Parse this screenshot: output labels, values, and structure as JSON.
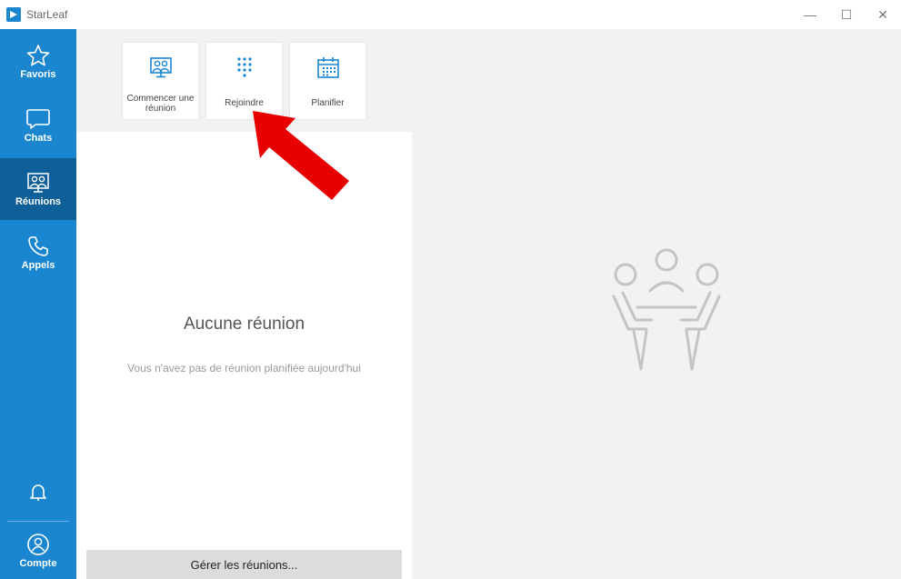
{
  "window": {
    "title": "StarLeaf",
    "minimize_glyph": "—",
    "maximize_glyph": "☐",
    "close_glyph": "✕"
  },
  "nav": {
    "items": [
      {
        "label": "Favoris",
        "icon": "star-icon",
        "active": false
      },
      {
        "label": "Chats",
        "icon": "chat-bubble-icon",
        "active": false
      },
      {
        "label": "Réunions",
        "icon": "meeting-icon",
        "active": true
      },
      {
        "label": "Appels",
        "icon": "phone-icon",
        "active": false
      }
    ],
    "bell_icon": "bell-icon",
    "account": {
      "label": "Compte",
      "icon": "account-icon"
    }
  },
  "actions": {
    "start": {
      "label_line1": "Commencer une",
      "label_line2": "réunion",
      "icon": "meeting-screen-icon"
    },
    "join": {
      "label": "Rejoindre",
      "icon": "dialpad-icon"
    },
    "schedule": {
      "label": "Planifier",
      "icon": "calendar-icon"
    }
  },
  "empty_state": {
    "title": "Aucune réunion",
    "subtitle": "Vous n'avez pas de réunion planifiée aujourd'hui"
  },
  "manage_button": "Gérer les réunions...",
  "colors": {
    "accent": "#1a86d0",
    "accent_active": "#0f5f99",
    "annotation_arrow": "#e80000"
  }
}
